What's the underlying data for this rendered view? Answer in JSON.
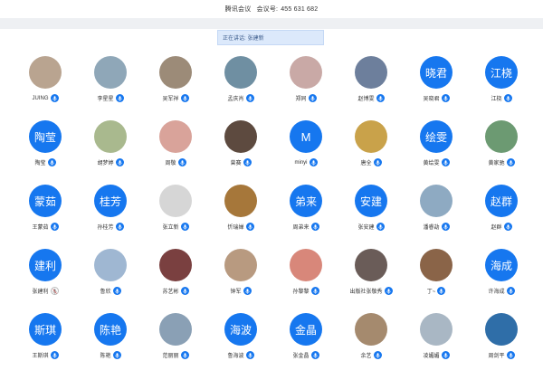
{
  "meeting": {
    "app_name": "腾讯会议",
    "id_label": "会议号:",
    "id_value": "455 631 682"
  },
  "speaking": {
    "label": "正在讲话:",
    "name": "张建新"
  },
  "participants": [
    {
      "name": "JUING",
      "avatar_text": "",
      "avatar_color": "#b9a490",
      "mic": "on"
    },
    {
      "name": "李星星",
      "avatar_text": "",
      "avatar_color": "#8fa7b8",
      "mic": "on"
    },
    {
      "name": "吴军祥",
      "avatar_text": "",
      "avatar_color": "#9c8b78",
      "mic": "on"
    },
    {
      "name": "孟庆肖",
      "avatar_text": "",
      "avatar_color": "#6f8fa2",
      "mic": "on"
    },
    {
      "name": "郑同",
      "avatar_text": "",
      "avatar_color": "#c9a9a6",
      "mic": "on"
    },
    {
      "name": "赵博雯",
      "avatar_text": "",
      "avatar_color": "#6d7f9c",
      "mic": "on"
    },
    {
      "name": "吴晓君",
      "avatar_text": "晓君",
      "avatar_color": "#1677ef",
      "mic": "on"
    },
    {
      "name": "江桡",
      "avatar_text": "江桡",
      "avatar_color": "#1677ef",
      "mic": "on"
    },
    {
      "name": "陶莹",
      "avatar_text": "陶莹",
      "avatar_color": "#1677ef",
      "mic": "on"
    },
    {
      "name": "胡梦婷",
      "avatar_text": "",
      "avatar_color": "#a9b98e",
      "mic": "on"
    },
    {
      "name": "周敬",
      "avatar_text": "",
      "avatar_color": "#d9a39a",
      "mic": "on"
    },
    {
      "name": "曾赛",
      "avatar_text": "",
      "avatar_color": "#5d4a3f",
      "mic": "on"
    },
    {
      "name": "minyi",
      "avatar_text": "M",
      "avatar_color": "#1677ef",
      "mic": "on"
    },
    {
      "name": "唐全",
      "avatar_text": "",
      "avatar_color": "#c9a24a",
      "mic": "on"
    },
    {
      "name": "黄绘雯",
      "avatar_text": "绘雯",
      "avatar_color": "#1677ef",
      "mic": "on"
    },
    {
      "name": "黄家驰",
      "avatar_text": "",
      "avatar_color": "#6c9a72",
      "mic": "on"
    },
    {
      "name": "王蒙茹",
      "avatar_text": "蒙茹",
      "avatar_color": "#1677ef",
      "mic": "on"
    },
    {
      "name": "孙桂芳",
      "avatar_text": "桂芳",
      "avatar_color": "#1677ef",
      "mic": "on"
    },
    {
      "name": "张立新",
      "avatar_text": "",
      "avatar_color": "#d6d6d6",
      "mic": "on"
    },
    {
      "name": "忻瑞婵",
      "avatar_text": "",
      "avatar_color": "#a6773a",
      "mic": "on"
    },
    {
      "name": "周弟来",
      "avatar_text": "弟来",
      "avatar_color": "#1677ef",
      "mic": "on"
    },
    {
      "name": "张安建",
      "avatar_text": "安建",
      "avatar_color": "#1677ef",
      "mic": "on"
    },
    {
      "name": "潘睿劼",
      "avatar_text": "",
      "avatar_color": "#8eaac2",
      "mic": "on"
    },
    {
      "name": "赵群",
      "avatar_text": "赵群",
      "avatar_color": "#1677ef",
      "mic": "on"
    },
    {
      "name": "张建利",
      "avatar_text": "建利",
      "avatar_color": "#1677ef",
      "mic": "off"
    },
    {
      "name": "鲁欣",
      "avatar_text": "",
      "avatar_color": "#9fb7d2",
      "mic": "on"
    },
    {
      "name": "苏艺彬",
      "avatar_text": "",
      "avatar_color": "#7a4040",
      "mic": "on"
    },
    {
      "name": "钟军",
      "avatar_text": "",
      "avatar_color": "#b89a80",
      "mic": "on"
    },
    {
      "name": "孙黎黎",
      "avatar_text": "",
      "avatar_color": "#d8877a",
      "mic": "on"
    },
    {
      "name": "出版社张敬秀",
      "avatar_text": "",
      "avatar_color": "#6a5c58",
      "mic": "on"
    },
    {
      "name": "丁~",
      "avatar_text": "",
      "avatar_color": "#8a6448",
      "mic": "on"
    },
    {
      "name": "许海成",
      "avatar_text": "海成",
      "avatar_color": "#1677ef",
      "mic": "on"
    },
    {
      "name": "王斯琪",
      "avatar_text": "斯琪",
      "avatar_color": "#1677ef",
      "mic": "on"
    },
    {
      "name": "陈艳",
      "avatar_text": "陈艳",
      "avatar_color": "#1677ef",
      "mic": "on"
    },
    {
      "name": "范丽丽",
      "avatar_text": "",
      "avatar_color": "#8aa0b5",
      "mic": "on"
    },
    {
      "name": "鲁海波",
      "avatar_text": "海波",
      "avatar_color": "#1677ef",
      "mic": "on"
    },
    {
      "name": "张金晶",
      "avatar_text": "金晶",
      "avatar_color": "#1677ef",
      "mic": "on"
    },
    {
      "name": "余艺",
      "avatar_text": "",
      "avatar_color": "#a58a6e",
      "mic": "on"
    },
    {
      "name": "凌媚媚",
      "avatar_text": "",
      "avatar_color": "#a9b7c4",
      "mic": "on"
    },
    {
      "name": "周剑平",
      "avatar_text": "",
      "avatar_color": "#2f6ea8",
      "mic": "on"
    }
  ],
  "icons": {
    "mic_on": "microphone-icon",
    "mic_off": "microphone-muted-icon"
  },
  "colors": {
    "accent": "#1677ef",
    "speaking_bg": "#dce9fb"
  }
}
